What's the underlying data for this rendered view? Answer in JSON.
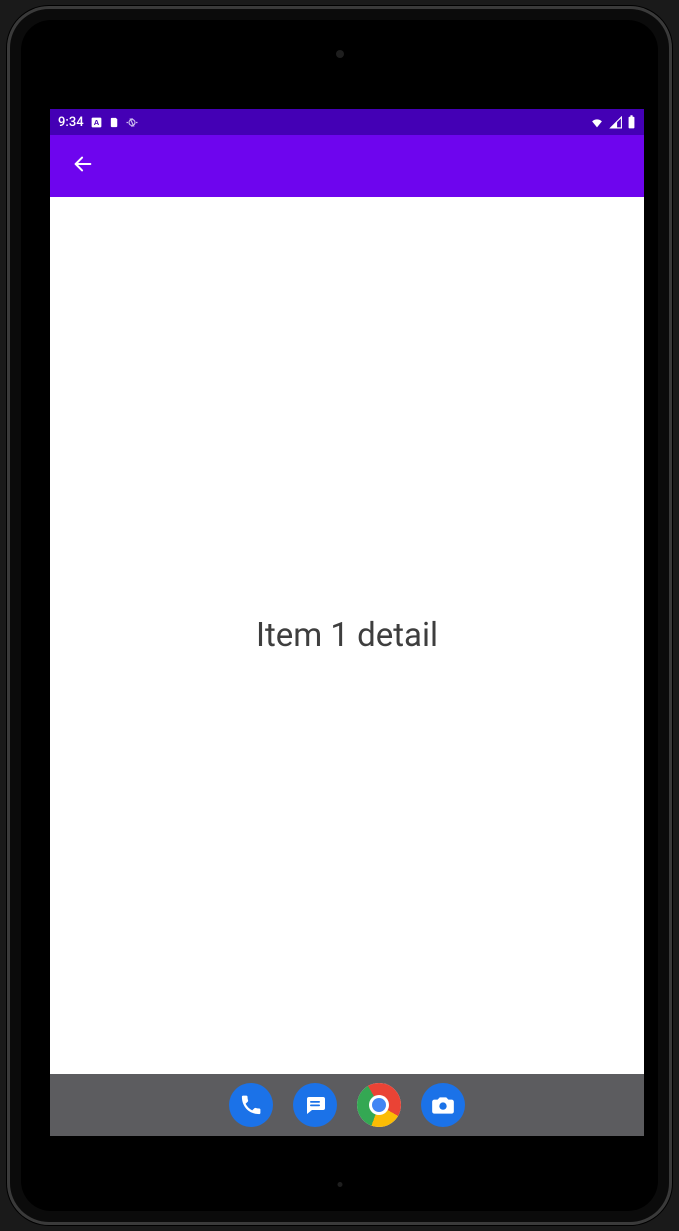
{
  "status_bar": {
    "time": "9:34",
    "icons_left": [
      "android-badge-icon",
      "sd-card-icon",
      "sync-icon"
    ],
    "icons_right": [
      "wifi-icon",
      "cell-signal-icon",
      "battery-icon"
    ]
  },
  "app_bar": {
    "back_icon": "back-arrow-icon"
  },
  "content": {
    "detail_text": "Item 1 detail"
  },
  "dock": {
    "items": [
      {
        "name": "phone-app-icon"
      },
      {
        "name": "messages-app-icon"
      },
      {
        "name": "chrome-app-icon"
      },
      {
        "name": "camera-app-icon"
      }
    ]
  },
  "colors": {
    "status_bar_bg": "#4400b5",
    "app_bar_bg": "#6e05ee",
    "dock_bg": "#5c5c5f",
    "dock_icon_blue": "#1b72e8"
  }
}
